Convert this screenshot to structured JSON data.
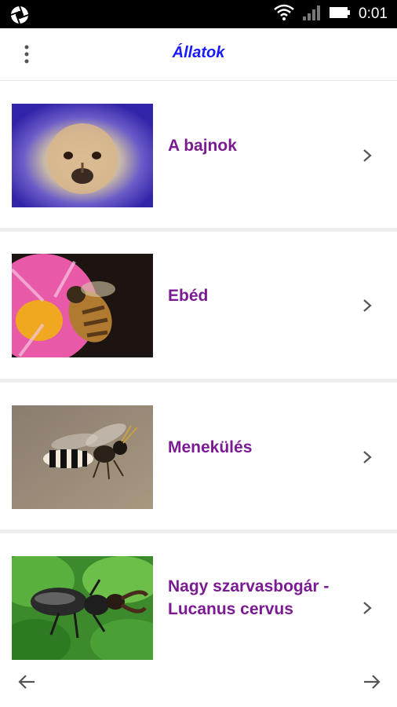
{
  "status_bar": {
    "time": "0:01",
    "icons": [
      "camera-aperture-icon",
      "wifi-icon",
      "signal-icon",
      "battery-icon"
    ]
  },
  "app_bar": {
    "title": "Állatok",
    "menu_icon": "more-vertical-icon"
  },
  "items": [
    {
      "label": "A bajnok",
      "thumbnail": "dog-face-photo"
    },
    {
      "label": "Ebéd",
      "thumbnail": "bee-on-pink-flower-photo"
    },
    {
      "label": "Menekülés",
      "thumbnail": "wasp-photo"
    },
    {
      "label": "Nagy szarvasbogár - Lucanus cervus",
      "thumbnail": "stag-beetle-on-leaves-photo"
    }
  ],
  "bottom_nav": {
    "back_icon": "arrow-left-icon",
    "forward_icon": "arrow-right-icon"
  },
  "colors": {
    "title": "#1a1aff",
    "item_label": "#7b1b92",
    "status_bar_bg": "#000000"
  }
}
